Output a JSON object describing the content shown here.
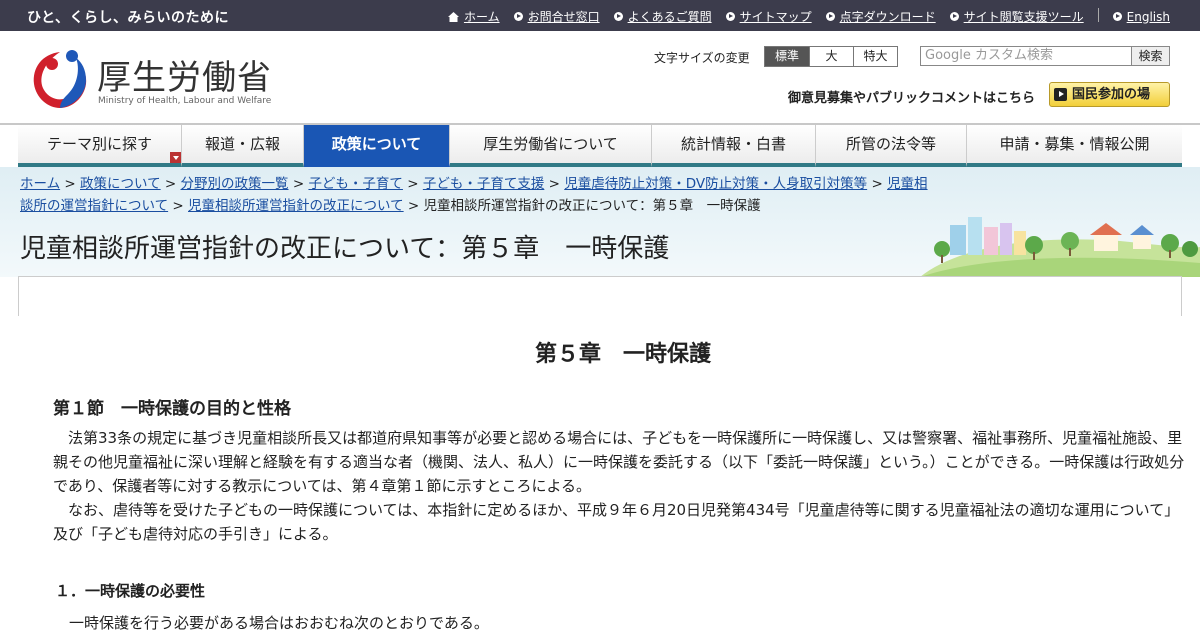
{
  "topbar": {
    "slogan": "ひと、くらし、みらいのために",
    "links": [
      "ホーム",
      "お問合せ窓口",
      "よくあるご質問",
      "サイトマップ",
      "点字ダウンロード",
      "サイト閲覧支援ツール",
      "English"
    ]
  },
  "header": {
    "logo_text": "厚生労働省",
    "logo_en": "Ministry of Health, Labour and Welfare",
    "fontsize_label": "文字サイズの変更",
    "fontsize_options": [
      "標準",
      "大",
      "特大"
    ],
    "search_placeholder": "Google カスタム検索",
    "search_button": "検索",
    "pubcomment": "御意見募集やパブリックコメントはこちら",
    "kokumin_button": "国民参加の場"
  },
  "nav": {
    "items": [
      "テーマ別に探す",
      "報道・広報",
      "政策について",
      "厚生労働省について",
      "統計情報・白書",
      "所管の法令等",
      "申請・募集・情報公開"
    ],
    "active_index": 2
  },
  "breadcrumb": {
    "items": [
      "ホーム",
      "政策について",
      "分野別の政策一覧",
      "子ども・子育て",
      "子ども・子育て支援",
      "児童虐待防止対策・DV防止対策・人身取引対策等",
      "児童相談所の運営指針について",
      "児童相談所運営指針の改正について"
    ],
    "current": "児童相談所運営指針の改正について：第５章　一時保護",
    "separator": ">"
  },
  "page": {
    "title": "児童相談所運営指針の改正について：第５章　一時保護",
    "chapter": "第５章　一時保護",
    "section": "第１節　一時保護の目的と性格",
    "para1": "　法第33条の規定に基づき児童相談所長又は都道府県知事等が必要と認める場合には、子どもを一時保護所に一時保護し、又は警察署、福祉事務所、児童福祉施設、里親その他児童福祉に深い理解と経験を有する適当な者（機関、法人、私人）に一時保護を委託する（以下「委託一時保護」という。）ことができる。一時保護は行政処分であり、保護者等に対する教示については、第４章第１節に示すところによる。",
    "para2": "　なお、虐待等を受けた子どもの一時保護については、本指針に定めるほか、平成９年６月20日児発第434号「児童虐待等に関する児童福祉法の適切な運用について」及び「子ども虐待対応の手引き」による。",
    "subsection": "１．一時保護の必要性",
    "para3": "一時保護を行う必要がある場合はおおむね次のとおりである。"
  },
  "colors": {
    "topbar": "#3c3c4c",
    "nav_active": "#1a56b4",
    "nav_underline": "#317a86",
    "link": "#1a4ea0",
    "kokumin": "#f2cf3a"
  }
}
